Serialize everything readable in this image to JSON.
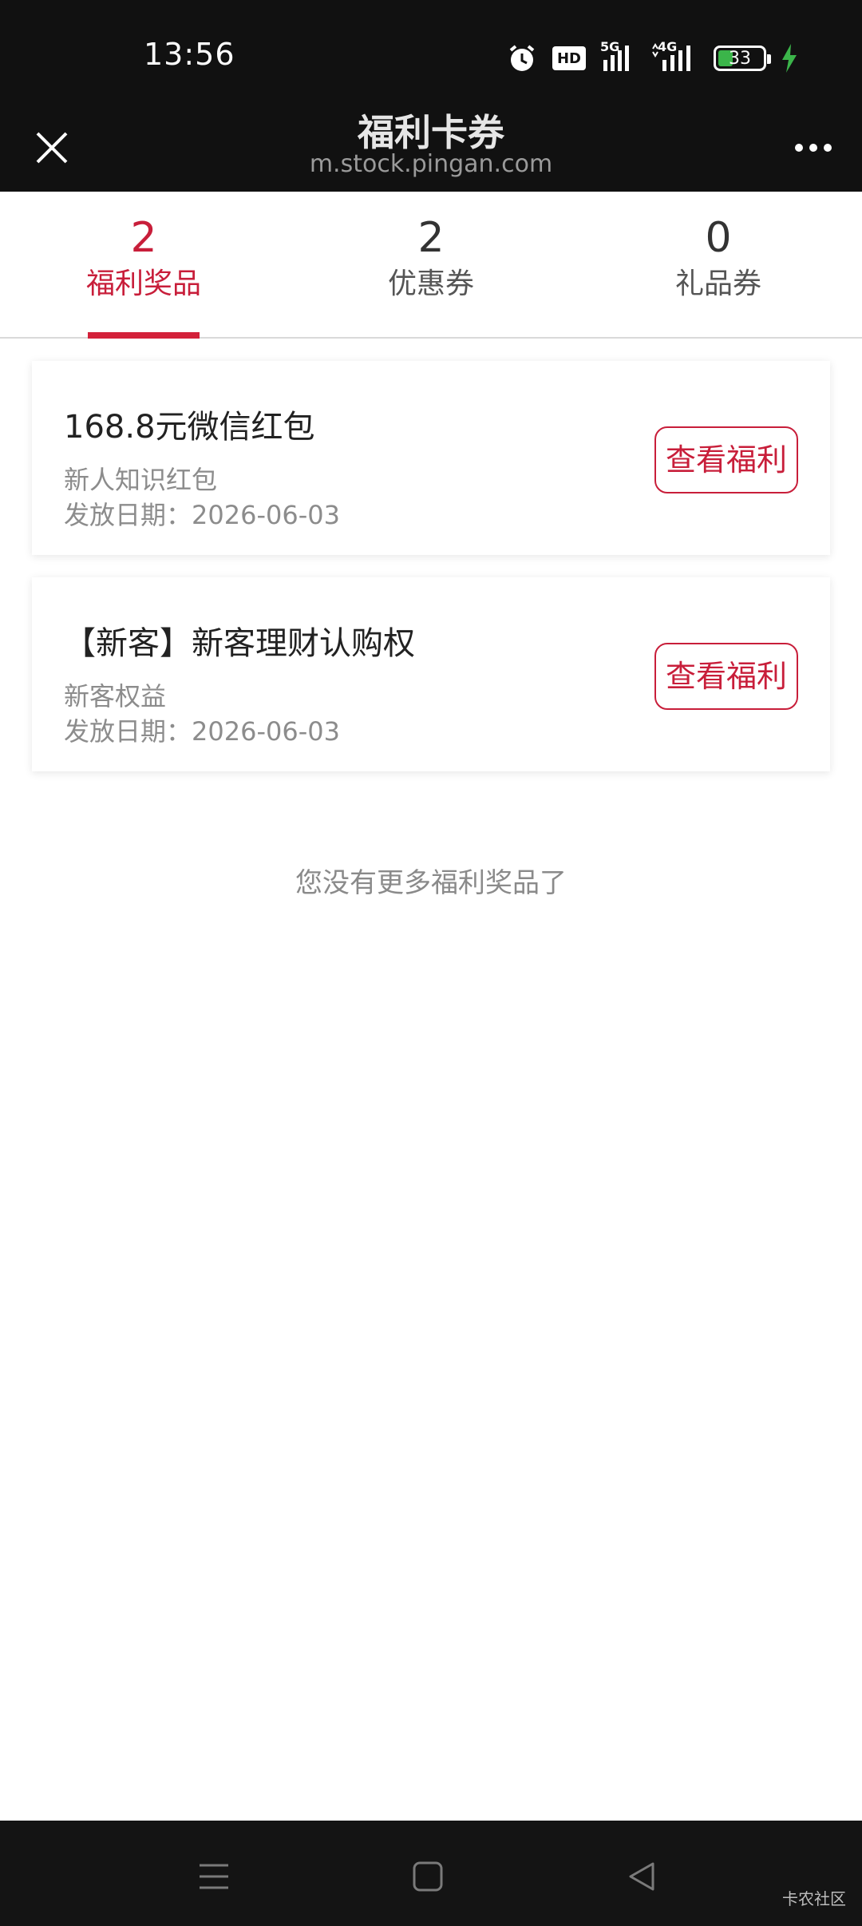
{
  "status_bar": {
    "time": "13:56",
    "battery_level": "33",
    "battery_fraction": 0.33,
    "icons": [
      "alarm-icon",
      "hd-icon",
      "signal-5g-icon",
      "signal-4g-icon",
      "battery-icon",
      "charging-icon"
    ],
    "hd_text": "HD",
    "net1_text": "5G",
    "net2_text": "4G"
  },
  "header": {
    "title": "福利卡券",
    "url": "m.stock.pingan.com"
  },
  "tabs": [
    {
      "count": "2",
      "label": "福利奖品",
      "active": true
    },
    {
      "count": "2",
      "label": "优惠券",
      "active": false
    },
    {
      "count": "0",
      "label": "礼品券",
      "active": false
    }
  ],
  "cards": [
    {
      "name": "168.8元微信红包",
      "desc": "新人知识红包",
      "date": "发放日期：2026-06-03",
      "button": "查看福利"
    },
    {
      "name": "【新客】新客理财认购权",
      "desc": "新客权益",
      "date": "发放日期：2026-06-03",
      "button": "查看福利"
    }
  ],
  "end_note": "您没有更多福利奖品了",
  "watermark": "卡农社区",
  "colors": {
    "accent": "#c81e3a",
    "header_bg": "#111111",
    "nav_bg": "#141414"
  }
}
